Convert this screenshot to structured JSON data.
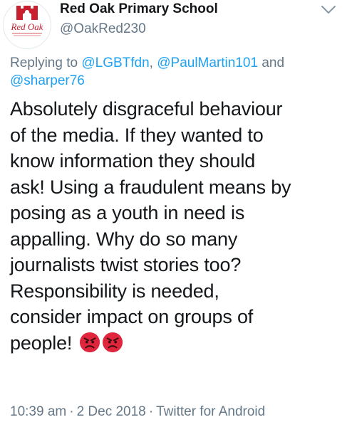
{
  "account": {
    "display_name": "Red Oak Primary School",
    "handle": "@OakRed230",
    "avatar_text": "Red Oak"
  },
  "reply": {
    "prefix": "Replying to",
    "mentions": [
      "@LGBTfdn",
      "@PaulMartin101",
      "@sharper76"
    ],
    "separator": ",",
    "and": "and"
  },
  "tweet": {
    "lines": [
      "Absolutely disgraceful behaviour",
      "of the media. If they wanted to",
      "know information they should",
      "ask! Using a fraudulent means by",
      "posing as a youth in need is",
      "appalling. Why do so many",
      "journalists twist stories too?",
      "Responsibility is needed,",
      "consider impact on groups of",
      "people!"
    ],
    "emojis": [
      "pouting-face-icon",
      "pouting-face-icon"
    ]
  },
  "meta": {
    "time": "10:39 am",
    "date": "2 Dec 2018",
    "dot": "·",
    "source": "Twitter for Android"
  },
  "colors": {
    "text": "#14171a",
    "secondary": "#657786",
    "link": "#1da1f2",
    "avatar_red": "#c8202f",
    "emoji_red": "#e0263c"
  },
  "icons": {
    "menu": "chevron-down-icon"
  }
}
